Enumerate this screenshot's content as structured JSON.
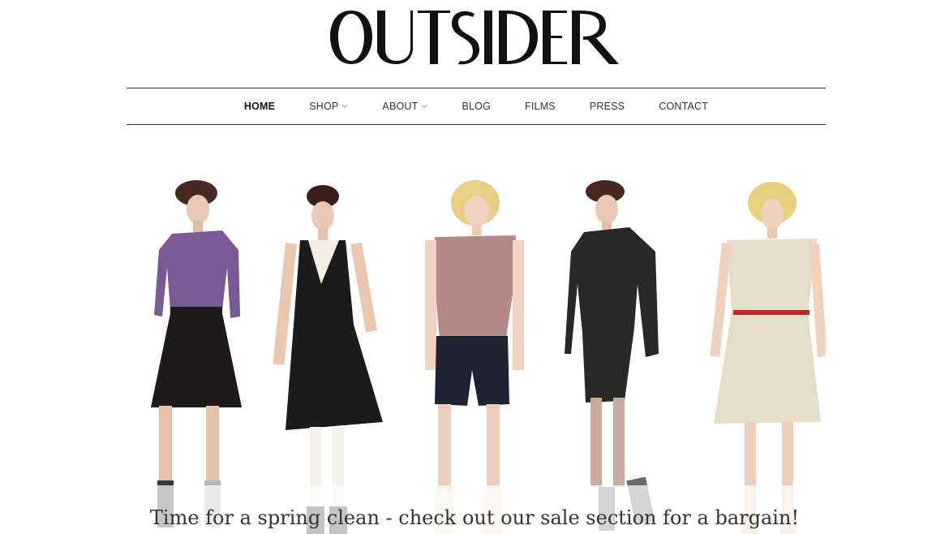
{
  "brand": {
    "name": "OUTSIDER"
  },
  "nav": {
    "items": [
      {
        "label": "HOME",
        "active": true,
        "has_dropdown": false
      },
      {
        "label": "SHOP",
        "active": false,
        "has_dropdown": true
      },
      {
        "label": "ABOUT",
        "active": false,
        "has_dropdown": true
      },
      {
        "label": "BLOG",
        "active": false,
        "has_dropdown": false
      },
      {
        "label": "FILMS",
        "active": false,
        "has_dropdown": false
      },
      {
        "label": "PRESS",
        "active": false,
        "has_dropdown": false
      },
      {
        "label": "CONTACT",
        "active": false,
        "has_dropdown": false
      }
    ]
  },
  "hero": {
    "caption": "Time for a spring clean - check out our sale section for a bargain!",
    "models": [
      {
        "name": "model-purple-blouse",
        "top": "#7a5a95",
        "bottom": "#1e1a1a",
        "hair": "#4a2a20"
      },
      {
        "name": "model-black-halter-dress",
        "top": "#1c1b1c",
        "bottom": "#1c1b1c",
        "hair": "#3a2018"
      },
      {
        "name": "model-pink-blouse-navy-shorts",
        "top": "#b48a88",
        "bottom": "#1d2132",
        "hair": "#e8cf84"
      },
      {
        "name": "model-black-suit",
        "top": "#2a2727",
        "bottom": "#252222",
        "hair": "#4a2a20"
      },
      {
        "name": "model-cream-shirt-dress",
        "top": "#e4ddc9",
        "bottom": "#e4ddc9",
        "hair": "#e8d07e"
      }
    ]
  },
  "colors": {
    "text": "#333333",
    "rule": "#333333",
    "belt_accent": "#c0272d"
  }
}
